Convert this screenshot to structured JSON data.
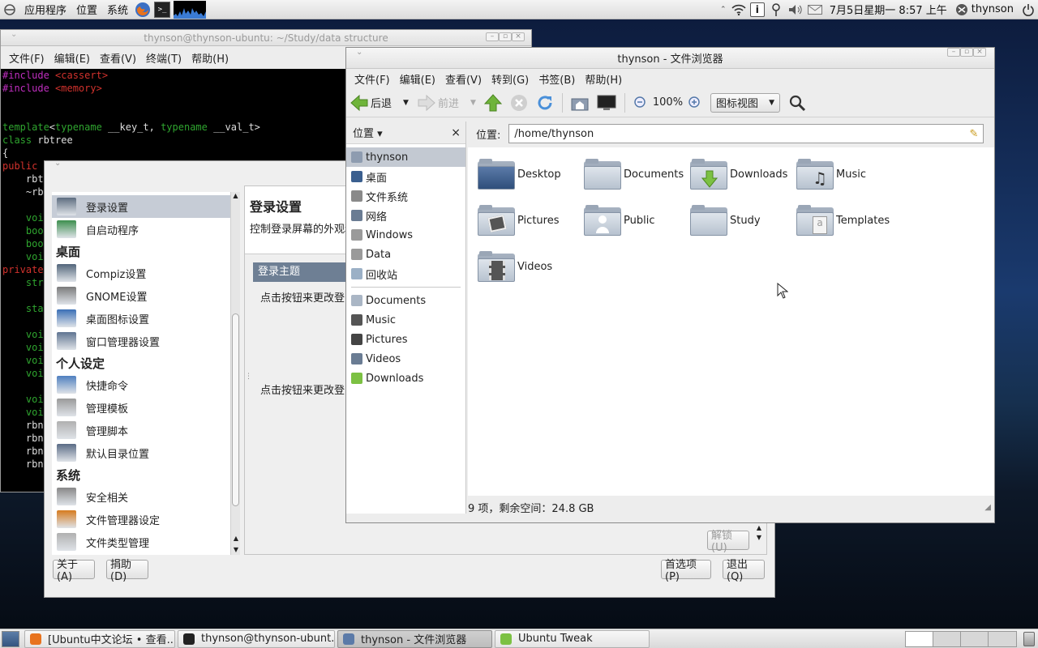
{
  "top_panel": {
    "apps": "应用程序",
    "places": "位置",
    "system": "系统",
    "datetime": "7月5日星期一  8:57 上午",
    "user": "thynson",
    "icons": [
      "ubuntu-logo-icon",
      "firefox-icon",
      "terminal-icon",
      "system-monitor-icon",
      "network-wifi-icon",
      "info-icon",
      "bluetooth-icon",
      "volume-icon",
      "mail-icon",
      "power-icon"
    ]
  },
  "terminal": {
    "title": "thynson@thynson-ubuntu: ~/Study/data structure",
    "menu": [
      "文件(F)",
      "编辑(E)",
      "查看(V)",
      "终端(T)",
      "帮助(H)"
    ],
    "code": [
      "#include <cassert>",
      "#include <memory>",
      "",
      "",
      "template<typename __key_t, typename __val_t>",
      "class rbtree",
      "{",
      "public",
      "    rbt",
      "    ~rb",
      "",
      "    voi",
      "    boo",
      "    boo",
      "    voi",
      "private",
      "    str",
      "",
      "    sta",
      "",
      "    voi",
      "    voi",
      "    voi",
      "    voi",
      "",
      "    voi",
      "    voi",
      "    rbn",
      "    rbn",
      "    rbn",
      "    rbn"
    ]
  },
  "tweak": {
    "title": "Ubuntu Tweak",
    "items": [
      {
        "type": "item",
        "label": "登录设置",
        "selected": true,
        "icon": "login-settings-icon"
      },
      {
        "type": "item",
        "label": "自启动程序",
        "icon": "autostart-icon"
      },
      {
        "type": "cat",
        "label": "桌面"
      },
      {
        "type": "item",
        "label": "Compiz设置",
        "icon": "compiz-icon"
      },
      {
        "type": "item",
        "label": "GNOME设置",
        "icon": "gnome-settings-icon"
      },
      {
        "type": "item",
        "label": "桌面图标设置",
        "icon": "desktop-icons-icon"
      },
      {
        "type": "item",
        "label": "窗口管理器设置",
        "icon": "window-manager-icon"
      },
      {
        "type": "cat",
        "label": "个人设定"
      },
      {
        "type": "item",
        "label": "快捷命令",
        "icon": "shortcut-command-icon"
      },
      {
        "type": "item",
        "label": "管理模板",
        "icon": "template-icon"
      },
      {
        "type": "item",
        "label": "管理脚本",
        "icon": "script-icon"
      },
      {
        "type": "item",
        "label": "默认目录位置",
        "icon": "default-folder-icon"
      },
      {
        "type": "cat",
        "label": "系统"
      },
      {
        "type": "item",
        "label": "安全相关",
        "icon": "security-icon"
      },
      {
        "type": "item",
        "label": "文件管理器设定",
        "icon": "file-manager-icon"
      },
      {
        "type": "item",
        "label": "文件类型管理",
        "icon": "file-type-icon"
      }
    ],
    "heading": "登录设置",
    "desc": "控制登录屏幕的外观和",
    "section": "登录主题",
    "click1": "点击按钮来更改登",
    "click2": "点击按钮来更改登",
    "unlock": "解锁(U)",
    "buttons": {
      "about": "关于(A)",
      "donate": "捐助(D)",
      "prefs": "首选项(P)",
      "quit": "退出(Q)"
    }
  },
  "filebrowser": {
    "title": "thynson - 文件浏览器",
    "menu": [
      "文件(F)",
      "编辑(E)",
      "查看(V)",
      "转到(G)",
      "书签(B)",
      "帮助(H)"
    ],
    "toolbar": {
      "back": "后退",
      "forward": "前进",
      "zoom": "100%",
      "view": "图标视图"
    },
    "sidebar_header": "位置 ▾",
    "location_label": "位置:",
    "path": "/home/thynson",
    "places": [
      {
        "label": "thynson",
        "selected": true,
        "icon": "home-icon"
      },
      {
        "label": "桌面",
        "icon": "desktop-icon"
      },
      {
        "label": "文件系统",
        "icon": "filesystem-icon"
      },
      {
        "label": "网络",
        "icon": "network-icon"
      },
      {
        "label": "Windows",
        "icon": "drive-icon"
      },
      {
        "label": "Data",
        "icon": "drive-icon"
      },
      {
        "label": "回收站",
        "icon": "trash-icon"
      }
    ],
    "bookmarks": [
      {
        "label": "Documents",
        "icon": "folder-icon"
      },
      {
        "label": "Music",
        "icon": "music-icon"
      },
      {
        "label": "Pictures",
        "icon": "pictures-icon"
      },
      {
        "label": "Videos",
        "icon": "videos-icon"
      },
      {
        "label": "Downloads",
        "icon": "downloads-icon"
      }
    ],
    "files": [
      "Desktop",
      "Documents",
      "Downloads",
      "Music",
      "Pictures",
      "Public",
      "Study",
      "Templates",
      "Videos"
    ],
    "status": "9 项，剩余空间：24.8 GB"
  },
  "taskbar": {
    "tasks": [
      "[Ubuntu中文论坛 • 查看...",
      "thynson@thynson-ubunt...",
      "thynson - 文件浏览器",
      "Ubuntu Tweak"
    ]
  }
}
